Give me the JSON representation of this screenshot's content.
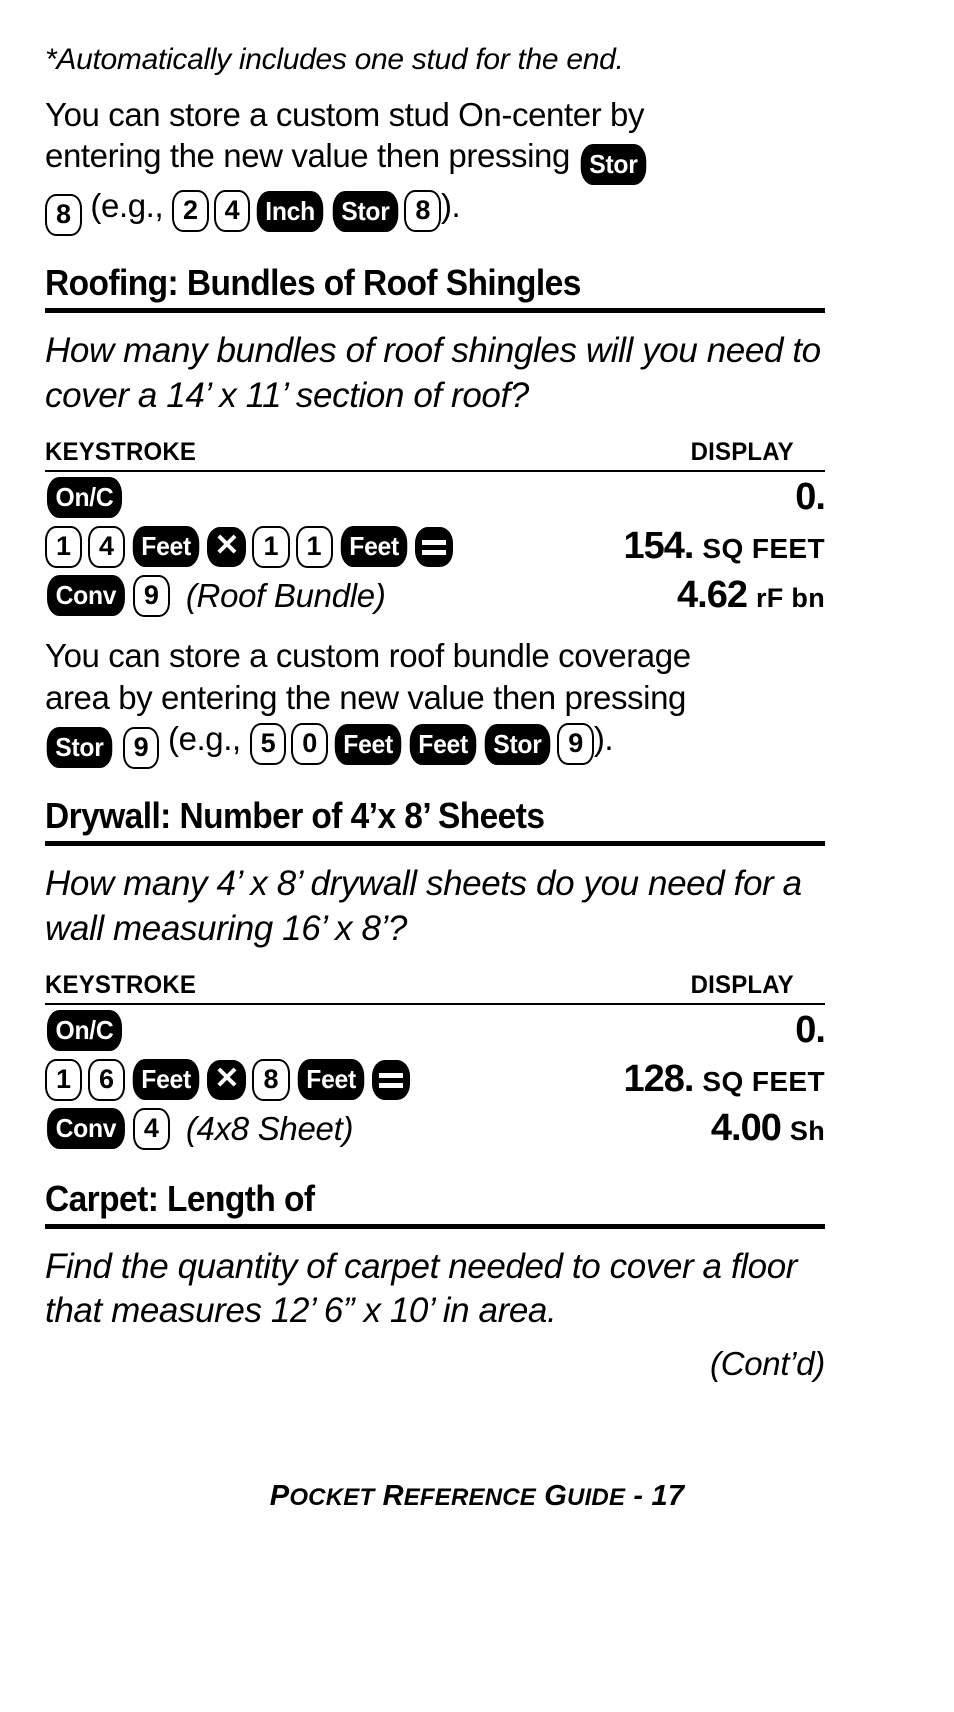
{
  "page": {
    "footnote": "*Automatically includes one stud for the end.",
    "footer_text": "POCKET REFERENCE GUIDE - 17",
    "footer_page_number": "17",
    "contd": "(Cont’d)"
  },
  "stud_note": {
    "line1": "You can store a custom stud On-center by",
    "line2_pre": "entering the new value then pressing",
    "key_stor": "Stor",
    "line3_key8": "8",
    "line3_eg": "(e.g.,",
    "eg_keys": [
      "2",
      "4",
      "Inch",
      "Stor",
      "8"
    ],
    "line3_close": ")."
  },
  "roofing": {
    "heading": "Roofing: Bundles of Roof Shingles",
    "question": "How many bundles of roof shingles will you need to cover a 14’ x 11’ section of roof?",
    "col_keystroke": "KEYSTROKE",
    "col_display": "DISPLAY",
    "rows": [
      {
        "keys": [
          {
            "label": "On/C",
            "type": "fn"
          }
        ],
        "annotation": "",
        "value": "0.",
        "unit": ""
      },
      {
        "keys": [
          {
            "label": "1",
            "type": "dg"
          },
          {
            "label": "4",
            "type": "dg"
          },
          {
            "label": "Feet",
            "type": "fn"
          },
          {
            "label": "×",
            "type": "op-x"
          },
          {
            "label": "1",
            "type": "dg"
          },
          {
            "label": "1",
            "type": "dg"
          },
          {
            "label": "Feet",
            "type": "fn"
          },
          {
            "label": "=",
            "type": "op-eq"
          }
        ],
        "annotation": "",
        "value": "154.",
        "unit": "SQ FEET"
      },
      {
        "keys": [
          {
            "label": "Conv",
            "type": "fn"
          },
          {
            "label": "9",
            "type": "dg"
          }
        ],
        "annotation": "(Roof Bundle)",
        "value": "4.62",
        "unit": "rF bn"
      }
    ],
    "note": {
      "line1": "You can store a custom roof bundle coverage",
      "line2": "area by entering the new value then pressing",
      "line3_keys": [
        "Stor",
        "9"
      ],
      "line3_eg": "(e.g.,",
      "eg_keys": [
        "5",
        "0",
        "Feet",
        "Feet",
        "Stor",
        "9"
      ],
      "line3_close": ")."
    }
  },
  "drywall": {
    "heading": "Drywall: Number of 4’x 8’ Sheets",
    "question": "How many 4’ x 8’ drywall sheets do you need for a wall measuring 16’ x 8’?",
    "col_keystroke": "KEYSTROKE",
    "col_display": "DISPLAY",
    "rows": [
      {
        "keys": [
          {
            "label": "On/C",
            "type": "fn"
          }
        ],
        "annotation": "",
        "value": "0.",
        "unit": ""
      },
      {
        "keys": [
          {
            "label": "1",
            "type": "dg"
          },
          {
            "label": "6",
            "type": "dg"
          },
          {
            "label": "Feet",
            "type": "fn"
          },
          {
            "label": "×",
            "type": "op-x"
          },
          {
            "label": "8",
            "type": "dg"
          },
          {
            "label": "Feet",
            "type": "fn"
          },
          {
            "label": "=",
            "type": "op-eq"
          }
        ],
        "annotation": "",
        "value": "128.",
        "unit": "SQ FEET"
      },
      {
        "keys": [
          {
            "label": "Conv",
            "type": "fn"
          },
          {
            "label": "4",
            "type": "dg"
          }
        ],
        "annotation": "(4x8 Sheet)",
        "value": "4.00",
        "unit": "Sh"
      }
    ]
  },
  "carpet": {
    "heading": "Carpet: Length of",
    "question": "Find the quantity of carpet needed to cover a floor that measures 12’ 6” x 10’ in area."
  }
}
